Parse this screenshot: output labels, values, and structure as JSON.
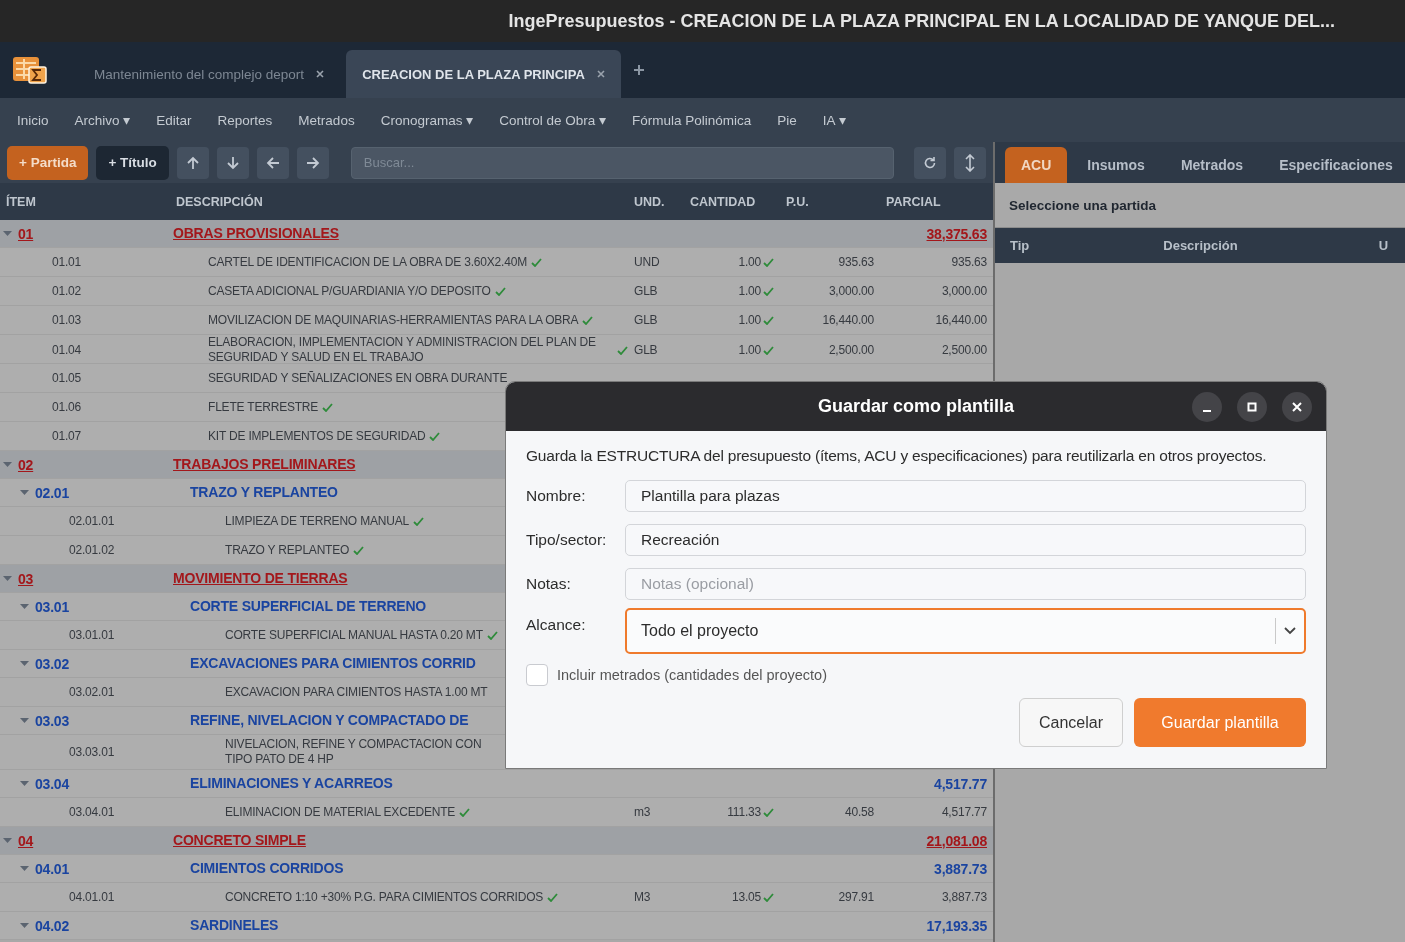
{
  "window": {
    "title": "IngePresupuestos  -  CREACION DE LA PLAZA PRINCIPAL EN LA LOCALIDAD DE YANQUE DEL..."
  },
  "doc_tabs": [
    {
      "label": "Mantenimiento del complejo deport",
      "selected": false
    },
    {
      "label": "CREACION DE LA PLAZA PRINCIPA",
      "selected": true
    }
  ],
  "menu": [
    "Inicio",
    "Archivo ▾",
    "Editar",
    "Reportes",
    "Metrados",
    "Cronogramas ▾",
    "Control de Obra ▾",
    "Fórmula Polinómica",
    "Pie",
    "IA ▾"
  ],
  "toolbar": {
    "buttons": [
      {
        "label": "+ Partida",
        "kind": "primary"
      },
      {
        "label": "+ Título",
        "kind": "dark"
      }
    ],
    "search": {
      "placeholder": "Buscar..."
    }
  },
  "table": {
    "columns": [
      "ÍTEM",
      "DESCRIPCIÓN",
      "UND.",
      "CANTIDAD",
      "P.U.",
      "PARCIAL"
    ],
    "rows": [
      {
        "kind": "group",
        "item": "01",
        "description": "OBRAS PROVISIONALES",
        "parcial": "38,375.63",
        "expanded": true,
        "children": [
          {
            "kind": "item",
            "item": "01.01",
            "description": "CARTEL DE IDENTIFICACION DE LA OBRA DE 3.60X2.40M",
            "und": "UND",
            "cantidad": "1.00",
            "pu": "935.63",
            "parcial": "935.63",
            "verified": true
          },
          {
            "kind": "item",
            "item": "01.02",
            "description": "CASETA ADICIONAL P/GUARDIANIA Y/O DEPOSITO",
            "und": "GLB",
            "cantidad": "1.00",
            "pu": "3,000.00",
            "parcial": "3,000.00",
            "verified": true
          },
          {
            "kind": "item",
            "item": "01.03",
            "description": "MOVILIZACION DE MAQUINARIAS-HERRAMIENTAS PARA LA OBRA",
            "und": "GLB",
            "cantidad": "1.00",
            "pu": "16,440.00",
            "parcial": "16,440.00",
            "verified": true
          },
          {
            "kind": "item",
            "item": "01.04",
            "description": "ELABORACION, IMPLEMENTACION Y ADMINISTRACION DEL PLAN DE SEGURIDAD Y SALUD EN EL TRABAJO",
            "und": "GLB",
            "cantidad": "1.00",
            "pu": "2,500.00",
            "parcial": "2,500.00",
            "verified": true
          },
          {
            "kind": "item",
            "item": "01.05",
            "description": "SEGURIDAD Y SEÑALIZACIONES EN OBRA DURANTE",
            "verified": false
          },
          {
            "kind": "item",
            "item": "01.06",
            "description": "FLETE TERRESTRE",
            "verified": true
          },
          {
            "kind": "item",
            "item": "01.07",
            "description": "KIT DE IMPLEMENTOS DE SEGURIDAD",
            "verified": true
          }
        ]
      },
      {
        "kind": "group",
        "item": "02",
        "description": "TRABAJOS  PRELIMINARES",
        "expanded": true,
        "children": [
          {
            "kind": "subgroup",
            "item": "02.01",
            "description": "TRAZO Y REPLANTEO",
            "expanded": true,
            "children": [
              {
                "kind": "item",
                "item": "02.01.01",
                "description": "LIMPIEZA DE TERRENO MANUAL",
                "verified": true
              },
              {
                "kind": "item",
                "item": "02.01.02",
                "description": "TRAZO Y REPLANTEO",
                "verified": true
              }
            ]
          }
        ]
      },
      {
        "kind": "group",
        "item": "03",
        "description": "MOVIMIENTO DE TIERRAS",
        "expanded": true,
        "children": [
          {
            "kind": "subgroup",
            "item": "03.01",
            "description": "CORTE SUPERFICIAL DE TERRENO",
            "expanded": true,
            "children": [
              {
                "kind": "item",
                "item": "03.01.01",
                "description": "CORTE SUPERFICIAL MANUAL HASTA 0.20 MT",
                "verified": true
              }
            ]
          },
          {
            "kind": "subgroup",
            "item": "03.02",
            "description": "EXCAVACIONES PARA CIMIENTOS CORRID",
            "expanded": true,
            "children": [
              {
                "kind": "item",
                "item": "03.02.01",
                "description": "EXCAVACION PARA CIMIENTOS HASTA 1.00 MT",
                "verified": false
              }
            ]
          },
          {
            "kind": "subgroup",
            "item": "03.03",
            "description": "REFINE, NIVELACION Y COMPACTADO DE",
            "expanded": true,
            "children": [
              {
                "kind": "item",
                "item": "03.03.01",
                "description": "NIVELACION, REFINE Y COMPACTACION CON\nTIPO PATO DE 4 HP",
                "verified": false
              }
            ]
          },
          {
            "kind": "subgroup",
            "item": "03.04",
            "description": "ELIMINACIONES Y ACARREOS",
            "parcial": "4,517.77",
            "expanded": true,
            "children": [
              {
                "kind": "item",
                "item": "03.04.01",
                "description": "ELIMINACION DE MATERIAL EXCEDENTE",
                "und": "m3",
                "cantidad": "111.33",
                "pu": "40.58",
                "parcial": "4,517.77",
                "verified": true
              }
            ]
          }
        ]
      },
      {
        "kind": "group",
        "item": "04",
        "description": "CONCRETO SIMPLE",
        "parcial": "21,081.08",
        "expanded": true,
        "children": [
          {
            "kind": "subgroup",
            "item": "04.01",
            "description": "CIMIENTOS CORRIDOS",
            "parcial": "3,887.73",
            "expanded": true,
            "children": [
              {
                "kind": "item",
                "item": "04.01.01",
                "description": "CONCRETO 1:10 +30% P.G. PARA CIMIENTOS CORRIDOS",
                "und": "M3",
                "cantidad": "13.05",
                "pu": "297.91",
                "parcial": "3,887.73",
                "verified": true
              }
            ]
          },
          {
            "kind": "subgroup",
            "item": "04.02",
            "description": "SARDINELES",
            "parcial": "17,193.35",
            "expanded": true
          }
        ]
      }
    ]
  },
  "side_panel": {
    "tabs": [
      {
        "label": "ACU",
        "selected": true
      },
      {
        "label": "Insumos",
        "selected": false
      },
      {
        "label": "Metrados",
        "selected": false
      },
      {
        "label": "Especificaciones",
        "selected": false
      }
    ],
    "message": "Seleccione una partida",
    "columns": [
      "Tip",
      "Descripción",
      "U"
    ]
  },
  "dialog": {
    "title": "Guardar como plantilla",
    "intro": "Guarda la ESTRUCTURA del presupuesto (ítems, ACU y especificaciones) para reutilizarla en otros proyectos.",
    "fields": [
      {
        "label": "Nombre:",
        "kind": "text",
        "value": "Plantilla para plazas",
        "focused": false
      },
      {
        "label": "Tipo/sector:",
        "kind": "text",
        "value": "Recreación",
        "focused": false
      },
      {
        "label": "Notas:",
        "kind": "text",
        "placeholder": "Notas (opcional)",
        "focused": false
      },
      {
        "label": "Alcance:",
        "kind": "select",
        "value": "Todo el proyecto",
        "focused": true
      }
    ],
    "checkbox": {
      "label": "Incluir metrados (cantidades del proyecto)",
      "checked": false
    },
    "buttons": [
      {
        "label": "Cancelar",
        "kind": "secondary"
      },
      {
        "label": "Guardar plantilla",
        "kind": "primary"
      }
    ]
  }
}
